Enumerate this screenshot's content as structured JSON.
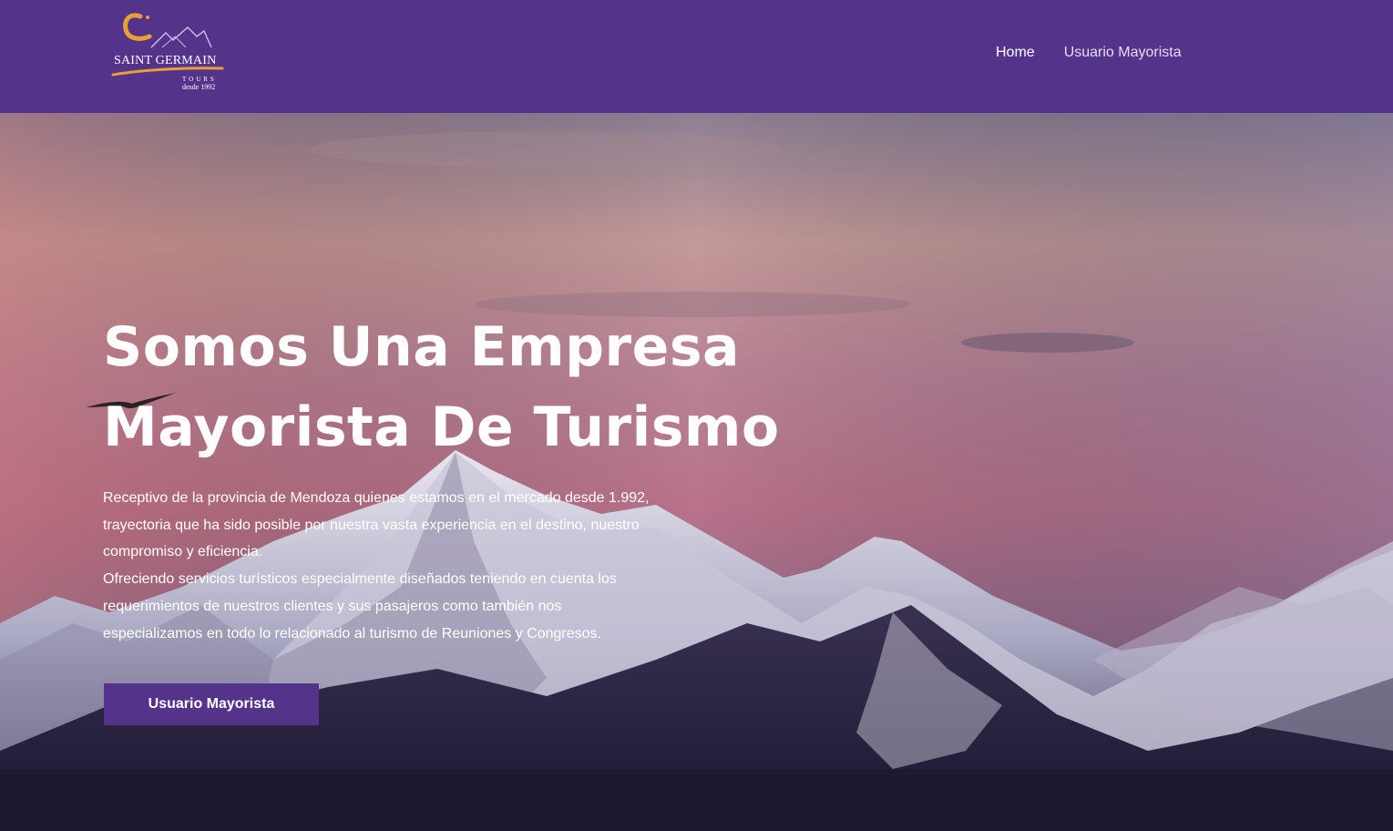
{
  "brand": {
    "name": "SAINT GERMAIN",
    "tagline": "TOURS",
    "since": "desde 1992",
    "colors": {
      "primary": "#54338a",
      "accent": "#e8a033"
    }
  },
  "nav": {
    "items": [
      {
        "label": "Home"
      },
      {
        "label": "Usuario Mayorista"
      }
    ]
  },
  "hero": {
    "title": "Somos Una Empresa Mayorista De Turismo",
    "paragraphs": [
      "Receptivo de la provincia de Mendoza quienes estamos en el mercado desde 1.992, trayectoria que ha sido posible por nuestra vasta experiencia en el destino, nuestro compromiso y eficiencia.",
      "Ofreciendo servicios turísticos especialmente diseñados teniendo en cuenta los requerimientos de nuestros clientes y sus pasajeros como también nos especializamos en todo lo relacionado al turismo de Reuniones y Congresos."
    ],
    "cta_label": "Usuario Mayorista"
  }
}
